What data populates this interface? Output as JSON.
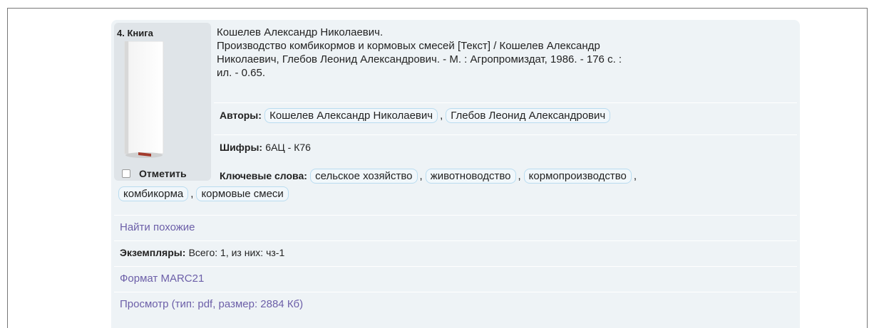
{
  "record": {
    "number": "4. Книга",
    "mark_label": "Отметить",
    "description": [
      "Кошелев Александр Николаевич.",
      "Производство комбикормов и кормовых смесей [Текст] / Кошелев Александр",
      "Николаевич, Глебов Леонид Александрович. - М. : Агропромиздат, 1986. - 176 с. :",
      "ил. - 0.65."
    ],
    "authors_label": "Авторы:",
    "authors": [
      "Кошелев Александр Николаевич",
      "Глебов Леонид Александрович"
    ],
    "codes_label": "Шифры:",
    "codes_value": "6АЦ - К76",
    "keywords_label": "Ключевые слова:",
    "keywords": [
      "сельское хозяйство",
      "животноводство",
      "кормопроизводство",
      "комбикорма",
      "кормовые смеси"
    ],
    "find_similar": "Найти похожие",
    "copies_label": "Экземпляры:",
    "copies_value": "Всего: 1, из них: чз-1",
    "marc_link": "Формат MARC21",
    "view_link": "Просмотр (тип: pdf, размер: 2884 Кб)",
    "separator": ","
  }
}
